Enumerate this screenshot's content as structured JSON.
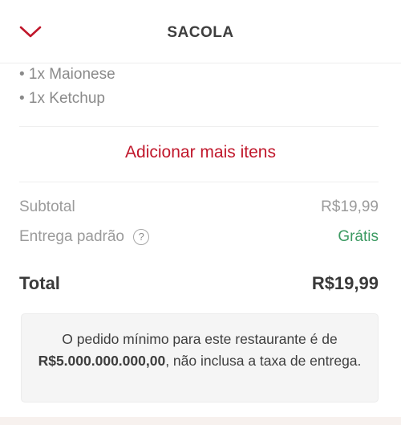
{
  "header": {
    "title": "SACOLA",
    "back_icon": "chevron-down-icon",
    "accent": "#c0172b"
  },
  "order": {
    "addons": [
      "• 1x Maionese",
      "• 1x Ketchup"
    ]
  },
  "add_more_label": "Adicionar mais itens",
  "summary": {
    "subtotal_label": "Subtotal",
    "subtotal_value": "R$19,99",
    "delivery_label": "Entrega padrão",
    "delivery_help_glyph": "?",
    "delivery_value": "Grátis",
    "total_label": "Total",
    "total_value": "R$19,99"
  },
  "notice": {
    "text_before": "O pedido mínimo para este restaurante é de",
    "min_value": "R$5.000.000.000,00",
    "text_after": ", não inclusa a taxa de entrega."
  }
}
